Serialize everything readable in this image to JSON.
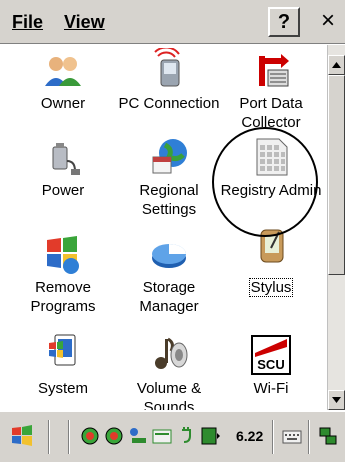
{
  "menubar": {
    "file": "File",
    "view": "View",
    "help": "?",
    "close": "×"
  },
  "items": [
    {
      "label": "Owner",
      "icon": "owner-icon"
    },
    {
      "label": "PC Connection",
      "icon": "pc-connection-icon"
    },
    {
      "label": "Port Data Collector",
      "icon": "port-data-collector-icon"
    },
    {
      "label": "Power",
      "icon": "power-icon"
    },
    {
      "label": "Regional Settings",
      "icon": "regional-settings-icon"
    },
    {
      "label": "Registry Admin",
      "icon": "registry-admin-icon"
    },
    {
      "label": "Remove Programs",
      "icon": "remove-programs-icon"
    },
    {
      "label": "Storage Manager",
      "icon": "storage-manager-icon"
    },
    {
      "label": "Stylus",
      "icon": "stylus-icon"
    },
    {
      "label": "System",
      "icon": "system-icon"
    },
    {
      "label": "Volume & Sounds",
      "icon": "volume-sounds-icon"
    },
    {
      "label": "Wi-Fi",
      "icon": "wifi-icon"
    }
  ],
  "taskbar": {
    "battery_text": "6.22",
    "icons": [
      "start-icon",
      "network-icon",
      "network2-icon",
      "usb-icon",
      "keyboard-icon",
      "power-plug-icon",
      "battery-icon",
      "input-panel-icon",
      "desktop-icon"
    ]
  },
  "colors": {
    "chrome": "#d6d3ce",
    "accent_red": "#cc0000",
    "accent_green": "#2e8b2e"
  }
}
